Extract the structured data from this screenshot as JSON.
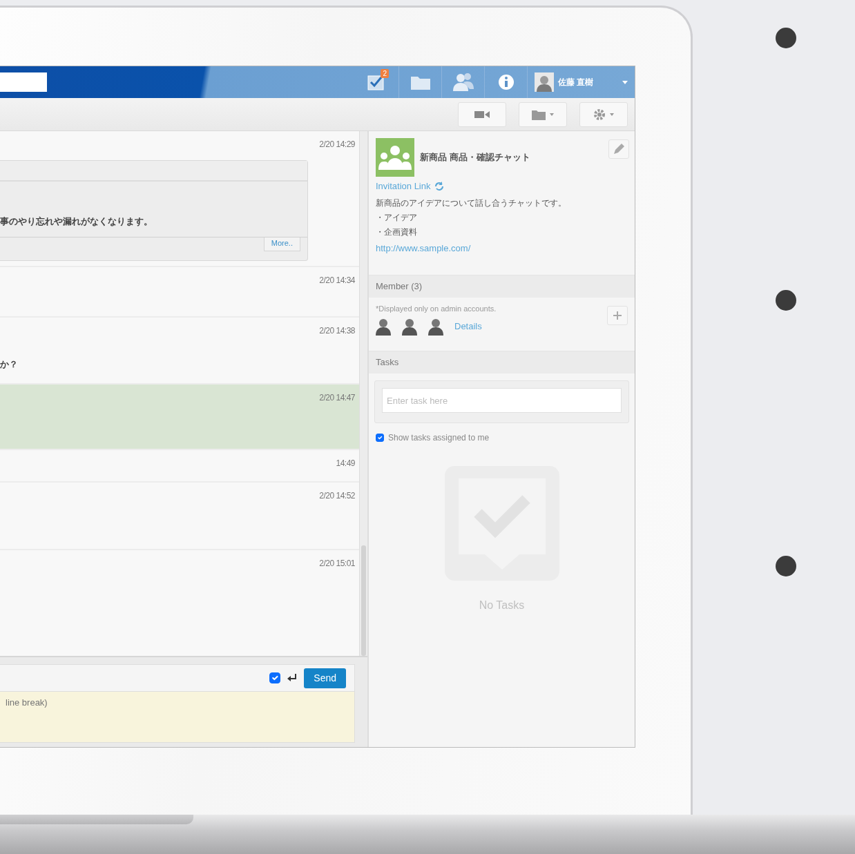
{
  "header": {
    "notification_count": "2",
    "user_name": "佐藤 直樹"
  },
  "messages": [
    {
      "time": "2/20 14:29",
      "highlighted": false,
      "card": {
        "text": "事のやり忘れや漏れがなくなります。",
        "link": "More.."
      }
    },
    {
      "time": "2/20 14:34",
      "highlighted": false
    },
    {
      "time": "2/20 14:38",
      "highlighted": false,
      "text": "か？"
    },
    {
      "time": "2/20 14:47",
      "highlighted": true
    },
    {
      "time": "14:49",
      "highlighted": false
    },
    {
      "time": "2/20 14:52",
      "highlighted": false
    },
    {
      "time": "2/20 15:01",
      "highlighted": false
    }
  ],
  "composer": {
    "enter_sends": true,
    "send_label": "Send",
    "placeholder": "line break)"
  },
  "panel": {
    "title": "新商品 商品・確認チャット",
    "invitation_link": "Invitation Link",
    "description": [
      "新商品のアイデアについて話し合うチャットです。",
      "・アイデア",
      "・企画資料"
    ],
    "url": "http://www.sample.com/",
    "member_header": "Member (3)",
    "member_note": "*Displayed only on admin accounts.",
    "members": [
      {
        "kind": "person"
      },
      {
        "kind": "person"
      },
      {
        "kind": "person"
      }
    ],
    "details_link": "Details",
    "tasks_header": "Tasks",
    "task_placeholder": "Enter task here",
    "show_mine": {
      "label": "Show tasks assigned to me",
      "checked": true
    },
    "empty_text": "No Tasks"
  },
  "side_bullets": [
    {
      "kind": "bullet"
    },
    {
      "kind": "bullet"
    },
    {
      "kind": "bullet"
    }
  ]
}
